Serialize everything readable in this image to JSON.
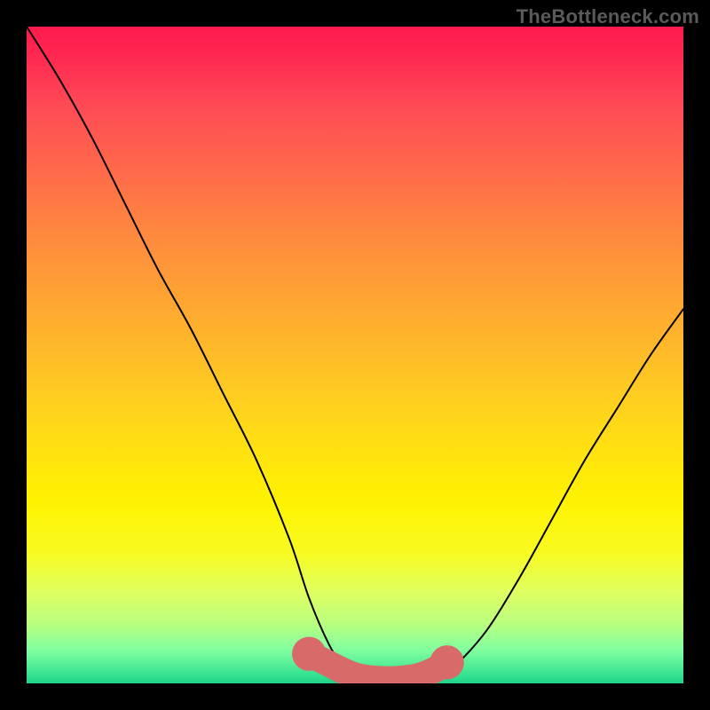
{
  "watermark": "TheBottleneck.com",
  "chart_data": {
    "type": "line",
    "title": "",
    "xlabel": "",
    "ylabel": "",
    "xlim": [
      0,
      100
    ],
    "ylim": [
      0,
      100
    ],
    "curve": {
      "x": [
        0,
        5,
        10,
        15,
        20,
        25,
        30,
        35,
        40,
        43,
        46,
        48,
        50,
        52,
        55,
        58,
        60,
        62,
        65,
        70,
        75,
        80,
        85,
        90,
        95,
        100
      ],
      "y": [
        100,
        92,
        83,
        73,
        63,
        54,
        44,
        34,
        22,
        13,
        6,
        3,
        1,
        0.5,
        0.3,
        0.4,
        0.6,
        1.0,
        2.5,
        8,
        16,
        25,
        34,
        42,
        50,
        57
      ]
    },
    "markers": {
      "x": [
        43,
        46,
        48,
        50,
        52,
        55,
        58,
        60,
        62,
        64
      ],
      "y": [
        4.5,
        3.0,
        2.0,
        1.2,
        0.8,
        0.6,
        0.8,
        1.2,
        2.0,
        3.2
      ],
      "color": "#d96a6a",
      "radius": 2.0
    },
    "colors": {
      "curve_stroke": "#000000",
      "marker_fill": "#d96a6a"
    }
  }
}
